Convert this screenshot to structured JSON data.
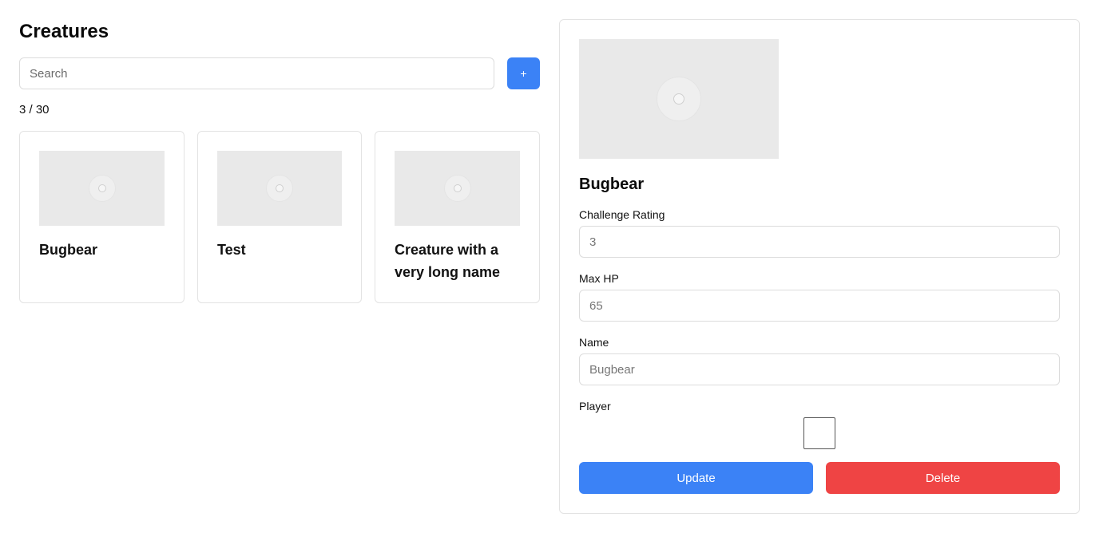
{
  "header": {
    "title": "Creatures"
  },
  "search": {
    "placeholder": "Search",
    "value": ""
  },
  "toolbar": {
    "add_label": "+"
  },
  "results": {
    "count_text": "3 / 30"
  },
  "creatures": [
    {
      "name": "Bugbear"
    },
    {
      "name": "Test"
    },
    {
      "name": "Creature with a very long name"
    }
  ],
  "detail": {
    "title": "Bugbear",
    "fields": {
      "challenge_rating": {
        "label": "Challenge Rating",
        "placeholder": "3"
      },
      "max_hp": {
        "label": "Max HP",
        "placeholder": "65"
      },
      "name": {
        "label": "Name",
        "placeholder": "Bugbear"
      },
      "player": {
        "label": "Player",
        "checked": false
      }
    },
    "update_label": "Update",
    "delete_label": "Delete"
  },
  "colors": {
    "accent": "#3b82f6",
    "danger": "#ef4444",
    "placeholder_bg": "#e9e9e9"
  },
  "icons": {
    "image_placeholder": "image-placeholder-icon"
  }
}
